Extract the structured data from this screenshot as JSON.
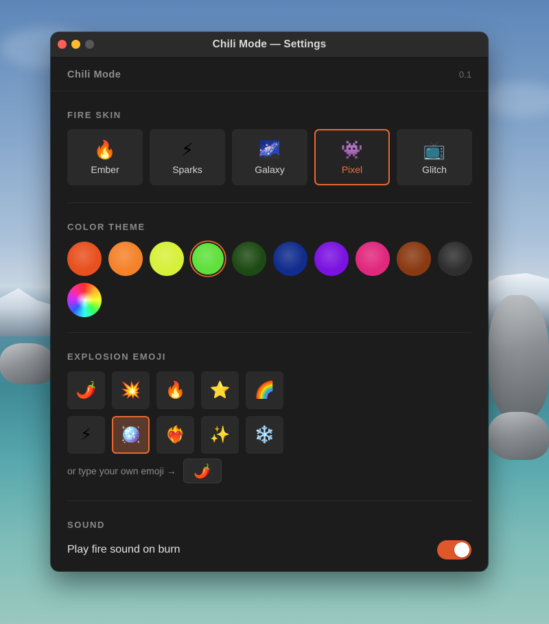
{
  "window": {
    "title": "Chili Mode — Settings"
  },
  "header": {
    "app_name": "Chili Mode",
    "version": "0.1"
  },
  "fire_skin": {
    "label": "FIRE SKIN",
    "selected": "Pixel",
    "options": [
      {
        "icon": "🔥",
        "icon_name": "fire-icon",
        "label": "Ember"
      },
      {
        "icon": "⚡",
        "icon_name": "lightning-icon",
        "label": "Sparks"
      },
      {
        "icon": "🌌",
        "icon_name": "galaxy-icon",
        "label": "Galaxy"
      },
      {
        "icon": "👾",
        "icon_name": "alien-monster-icon",
        "label": "Pixel"
      },
      {
        "icon": "📺",
        "icon_name": "television-icon",
        "label": "Glitch"
      }
    ]
  },
  "color_theme": {
    "label": "COLOR THEME",
    "selected_index": 3,
    "swatches": [
      {
        "name": "red-orange",
        "color": "#e8501e"
      },
      {
        "name": "orange",
        "color": "#f4822a"
      },
      {
        "name": "yellow-lime",
        "color": "#d7f03a"
      },
      {
        "name": "green",
        "color": "#5fe03c"
      },
      {
        "name": "dark-green",
        "color": "#1d4a14"
      },
      {
        "name": "navy",
        "color": "#102c8c"
      },
      {
        "name": "purple",
        "color": "#7a12e0"
      },
      {
        "name": "pink",
        "color": "#e0287c"
      },
      {
        "name": "brown",
        "color": "#8a3a12"
      },
      {
        "name": "charcoal",
        "color": "#2e2e2e"
      },
      {
        "name": "rainbow",
        "color": "rainbow"
      }
    ]
  },
  "explosion_emoji": {
    "label": "EXPLOSION EMOJI",
    "selected_index": 6,
    "options": [
      {
        "emoji": "🌶️",
        "name": "hot-pepper-icon"
      },
      {
        "emoji": "💥",
        "name": "collision-icon"
      },
      {
        "emoji": "🔥",
        "name": "fire-icon"
      },
      {
        "emoji": "⭐",
        "name": "star-icon"
      },
      {
        "emoji": "🌈",
        "name": "rainbow-icon"
      },
      {
        "emoji": "⚡",
        "name": "lightning-icon"
      },
      {
        "emoji": "🪩",
        "name": "mirror-ball-icon"
      },
      {
        "emoji": "❤️‍🔥",
        "name": "heart-on-fire-icon"
      },
      {
        "emoji": "✨",
        "name": "sparkles-icon"
      },
      {
        "emoji": "❄️",
        "name": "snowflake-icon"
      }
    ],
    "custom_label": "or type your own emoji →",
    "custom_value": "🌶️"
  },
  "sound": {
    "label": "SOUND",
    "play_fire_sound_label": "Play fire sound on burn",
    "enabled": true
  },
  "colors": {
    "accent": "#e8692f",
    "toggle_on": "#e0582a"
  }
}
